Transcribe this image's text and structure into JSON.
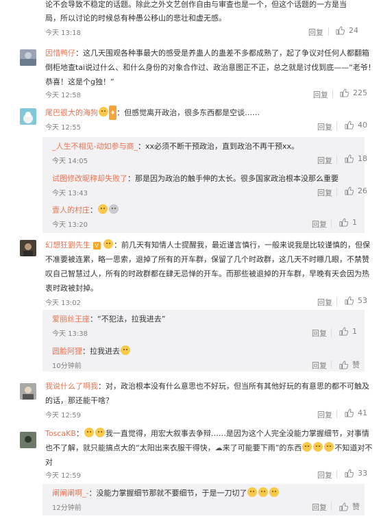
{
  "labels": {
    "reply": "回复",
    "like_text": "赞"
  },
  "colors": {
    "name": "#eb7350",
    "text": "#333333",
    "meta": "#808080",
    "sub_bg": "#f2f2f5"
  },
  "c0": {
    "text1": "论不会导致不稳定的话题。除此之外文艺创作自由与审查也是一个，但这个话题的一方是当",
    "text2": "局，所以讨论的时候总有种愚公移山的悲壮和虚无感。",
    "time": "今天 13:18",
    "likes": "24"
  },
  "c1": {
    "name": "因惜鸭仔",
    "text1": "：这几天围观各种事最大的感受是养蛊人的蛊差不多都成熟了，起了争议对任何人都翻箱",
    "text2": "倒柜地查tai说过什么、和什么身份的对象合作过、政治意图正不正，总之就是讨伐到底——“老爷！",
    "text3": "恭喜！这是个g独！”",
    "time": "今天 12:58",
    "likes": "225"
  },
  "c2": {
    "name": "尾巴很大的海狗",
    "text": "：但感觉离开政治，很多东西都是空谈……",
    "time": "今天 12:55",
    "likes": "40"
  },
  "c2r1": {
    "name": "_人生不相见-动如参与商_",
    "text": "：xx必须不断干预政治，直到政治不再干预xx。",
    "time": "今天 14:05",
    "likes": "18"
  },
  "c2r2": {
    "name": "试图修改昵称却失败了",
    "text": "：那是因为政治的触手伸的太长。很多国家政治根本没那么重要",
    "time": "今天 13:43",
    "likes": "26"
  },
  "c2r3": {
    "name": "壹人的村庄",
    "time": "今天 13:20",
    "likes": "1"
  },
  "c3": {
    "name": "幻想狂劉先生",
    "text1": "：前几天有知情人士提醒我，最近谨言慎行，一般来说我是比较谨慎的，但保",
    "text2": "不准要被连累，略一思索，退掉了所有的开车群，保留了几个时政群，这几天不时瞟几眼，不禁赞",
    "text3": "叹自己智慧过人，所有的时政群都在肆无忌惮的开车。而那些被退掉的开车群，早晚有天会因为热",
    "text4": "衷时政被封掉。",
    "time": "今天 13:02",
    "likes": "53"
  },
  "c3r1": {
    "name": "爱丽丝王座",
    "text": "：“不犯法，拉我进去”",
    "time": "今天 13:38",
    "likes": "1"
  },
  "c3r2": {
    "name": "圆脸阿狸",
    "text": "：拉我进去",
    "time": "10分钟前"
  },
  "c4": {
    "name": "我说什么了啊我",
    "text1": "：对，政治根本没有什么意思也不好玩，但当所有其他好玩的有意思的都不可触及",
    "text2": "的话，那还能干啥？",
    "time": "今天 12:59",
    "likes": "41"
  },
  "c5": {
    "name": "ToscaKB",
    "text1a": "：",
    "text1b": "我一直觉得，用宏大叙事去争辩……是因为这个人完全没能力掌握细节，对事情",
    "text2": "也不了解，就只能搞点大的“太阳出来衣服干得快，",
    "text2b": "来了可能要下雨”的东西",
    "text2c": "不知道对不",
    "text3": "对",
    "time": "今天 12:59",
    "likes": "33"
  },
  "c5r1": {
    "name": "阐阐阐啊_-",
    "text": "：没能力掌握细节那就不要细节，于是一刀切了",
    "time": "12分钟前"
  }
}
